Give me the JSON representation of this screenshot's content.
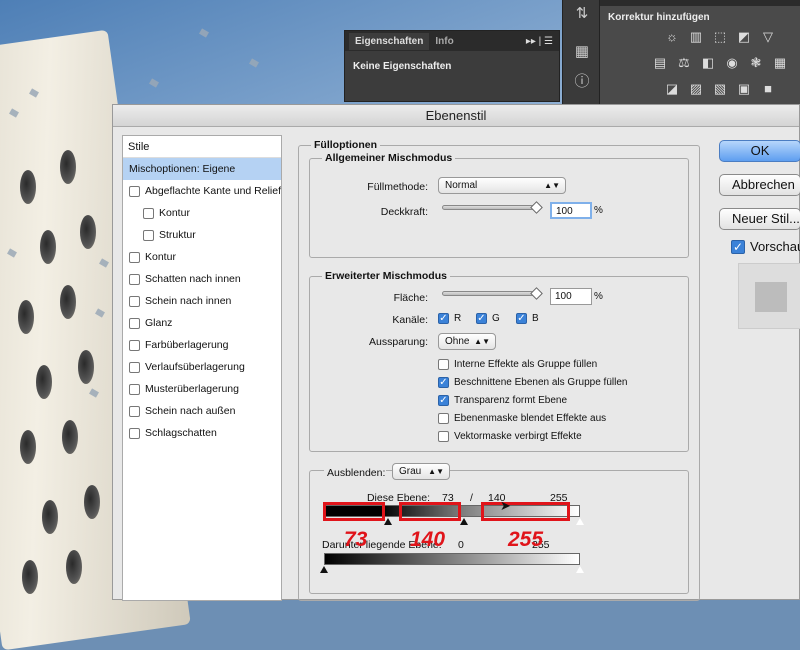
{
  "properties_panel": {
    "tabs": [
      "Eigenschaften",
      "Info"
    ],
    "menu_glyph": "▸▸ | ☰",
    "empty_text": "Keine Eigenschaften"
  },
  "korrektur_panel": {
    "title": "Korrektur hinzufügen"
  },
  "dialog": {
    "title": "Ebenenstil",
    "styles_header": "Stile",
    "styles": [
      {
        "label": "Mischoptionen: Eigene",
        "selected": true,
        "checkbox": false,
        "indent": false
      },
      {
        "label": "Abgeflachte Kante und Relief",
        "checkbox": true,
        "indent": false
      },
      {
        "label": "Kontur",
        "checkbox": true,
        "indent": true
      },
      {
        "label": "Struktur",
        "checkbox": true,
        "indent": true
      },
      {
        "label": "Kontur",
        "checkbox": true,
        "indent": false
      },
      {
        "label": "Schatten nach innen",
        "checkbox": true,
        "indent": false
      },
      {
        "label": "Schein nach innen",
        "checkbox": true,
        "indent": false
      },
      {
        "label": "Glanz",
        "checkbox": true,
        "indent": false
      },
      {
        "label": "Farbüberlagerung",
        "checkbox": true,
        "indent": false
      },
      {
        "label": "Verlaufsüberlagerung",
        "checkbox": true,
        "indent": false
      },
      {
        "label": "Musterüberlagerung",
        "checkbox": true,
        "indent": false
      },
      {
        "label": "Schein nach außen",
        "checkbox": true,
        "indent": false
      },
      {
        "label": "Schlagschatten",
        "checkbox": true,
        "indent": false
      }
    ],
    "fill_options": "Fülloptionen",
    "general": {
      "legend": "Allgemeiner Mischmodus",
      "blend_mode_label": "Füllmethode:",
      "blend_mode_value": "Normal",
      "opacity_label": "Deckkraft:",
      "opacity_value": "100",
      "percent": "%"
    },
    "advanced": {
      "legend": "Erweiterter Mischmodus",
      "fill_label": "Fläche:",
      "fill_value": "100",
      "percent": "%",
      "channels_label": "Kanäle:",
      "channels": [
        "R",
        "G",
        "B"
      ],
      "knockout_label": "Aussparung:",
      "knockout_value": "Ohne",
      "options": [
        {
          "label": "Interne Effekte als Gruppe füllen",
          "checked": false
        },
        {
          "label": "Beschnittene Ebenen als Gruppe füllen",
          "checked": true
        },
        {
          "label": "Transparenz formt Ebene",
          "checked": true
        },
        {
          "label": "Ebenenmaske blendet Effekte aus",
          "checked": false
        },
        {
          "label": "Vektormaske verbirgt Effekte",
          "checked": false
        }
      ]
    },
    "blend_if": {
      "label": "Ausblenden:",
      "value": "Grau",
      "this_layer_label": "Diese Ebene:",
      "this_layer_v1": "73",
      "this_layer_sep": "/",
      "this_layer_v2": "140",
      "this_layer_v3": "255",
      "underlying_label": "Darunter liegende Ebene:",
      "underlying_v1": "0",
      "underlying_v2": "255"
    },
    "annotations": [
      "73",
      "140",
      "255"
    ],
    "buttons": {
      "ok": "OK",
      "cancel": "Abbrechen",
      "new_style": "Neuer Stil...",
      "preview": "Vorschau"
    }
  },
  "colors": {
    "annotation_red": "#e0141a",
    "selection_blue": "#b5d2f3",
    "checkbox_blue": "#3b82d8"
  }
}
